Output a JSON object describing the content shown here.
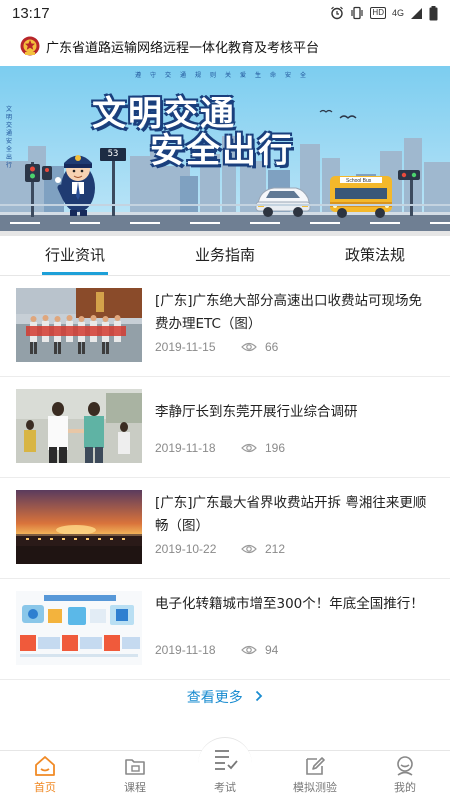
{
  "status_bar": {
    "time": "13:17",
    "hd": "HD",
    "network": "4G"
  },
  "header": {
    "title": "广东省道路运输网络远程一体化教育及考核平台"
  },
  "banner": {
    "slogan_top": "遵守交通规则关爱生命安全",
    "title_line1": "文明交通",
    "title_line2": "安全出行",
    "side_text": "文明交通安全出行",
    "signal_number": "53",
    "bus_label": "School Bus"
  },
  "tabs": [
    {
      "label": "行业资讯",
      "active": true
    },
    {
      "label": "业务指南",
      "active": false
    },
    {
      "label": "政策法规",
      "active": false
    }
  ],
  "news": [
    {
      "title": "[广东]广东绝大部分高速出口收费站可现场免费办理ETC（图）",
      "date": "2019-11-15",
      "views": "66"
    },
    {
      "title": "李静厅长到东莞开展行业综合调研",
      "date": "2019-11-18",
      "views": "196"
    },
    {
      "title": "[广东]广东最大省界收费站开拆 粤湘往来更顺畅（图）",
      "date": "2019-10-22",
      "views": "212"
    },
    {
      "title": "电子化转籍城市增至300个！年底全国推行！",
      "date": "2019-11-18",
      "views": "94"
    }
  ],
  "view_more": "查看更多",
  "bottom_nav": [
    {
      "label": "首页",
      "icon": "home-icon",
      "active": true
    },
    {
      "label": "课程",
      "icon": "course-icon",
      "active": false
    },
    {
      "label": "考试",
      "icon": "exam-icon",
      "active": false
    },
    {
      "label": "模拟测验",
      "icon": "edit-icon",
      "active": false
    },
    {
      "label": "我的",
      "icon": "profile-icon",
      "active": false
    }
  ],
  "colors": {
    "accent": "#1da0d8",
    "nav_active": "#f08a26",
    "link": "#1a8cd0"
  }
}
